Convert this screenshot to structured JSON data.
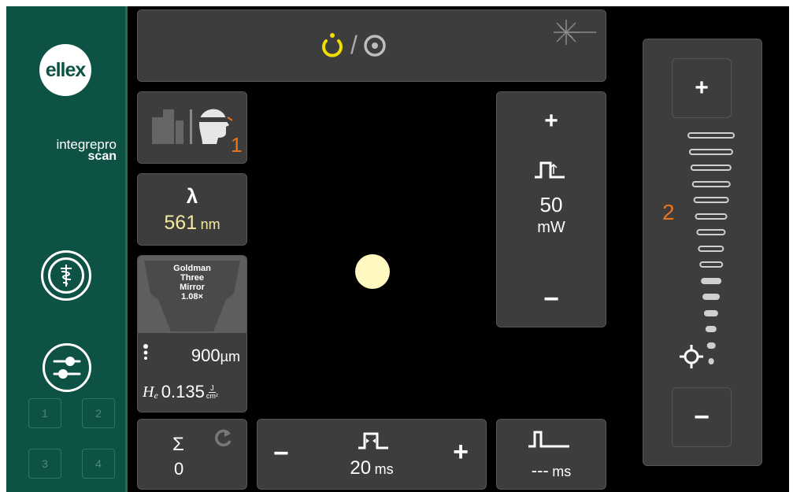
{
  "sidebar": {
    "logo_text": "ellex",
    "brand_line1": "integrepro",
    "brand_line2": "scan",
    "presets": [
      "1",
      "2",
      "3",
      "4"
    ]
  },
  "top_bar": {
    "mode_separator": "/",
    "ready_color": "#f0e000"
  },
  "illumination": {
    "number": "1"
  },
  "wavelength": {
    "symbol": "λ",
    "value": "561",
    "unit": "nm"
  },
  "lens": {
    "name_line1": "Goldman",
    "name_line2": "Three",
    "name_line3": "Mirror",
    "magnification": "1.08×",
    "spot_size": "900",
    "spot_unit": "µm",
    "fluence_label": "H",
    "fluence_sub": "e",
    "fluence_value": "0.135",
    "fluence_unit_num": "J",
    "fluence_unit_den": "cm²"
  },
  "power": {
    "plus": "+",
    "minus": "−",
    "value": "50",
    "unit": "mW"
  },
  "counter": {
    "symbol": "Σ",
    "value": "0"
  },
  "duration": {
    "minus": "−",
    "plus": "+",
    "value": "20",
    "unit": "ms"
  },
  "interval": {
    "value": "---",
    "unit": "ms"
  },
  "aiming": {
    "number": "2",
    "plus": "+",
    "minus": "−",
    "level_fraction": 0.4
  },
  "colors": {
    "sidebar": "#0e5245",
    "panel": "#3d3d3d",
    "accent_orange": "#e8741e",
    "aiming_beam": "#fff8c0"
  }
}
